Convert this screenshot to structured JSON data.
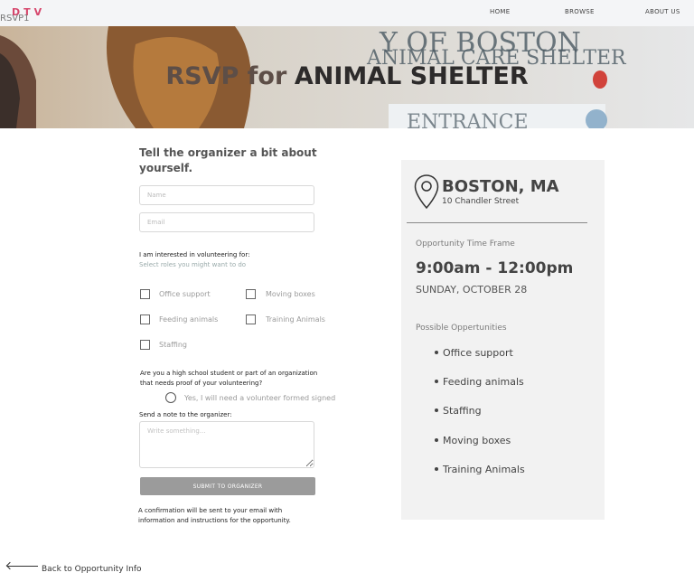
{
  "nav": {
    "logo": "DTV",
    "tab_title": "RSVP1",
    "links": [
      "HOME",
      "BROWSE",
      "ABOUT US"
    ]
  },
  "hero": {
    "title_part1": "RSVP for",
    "title_part2": "ANIMAL SHELTER",
    "background_sign_line1": "Y OF BOSTON",
    "background_sign_line2": "ANIMAL CARE SHELTER",
    "background_sign_line3": "ENTRANCE"
  },
  "form": {
    "heading": "Tell the organizer a bit about yourself.",
    "name_placeholder": "Name",
    "email_placeholder": "Email",
    "interest_label": "I am interested in volunteering for:",
    "interest_hint": "Select roles you might want to do",
    "roles": [
      "Office support",
      "Moving boxes",
      "Feeding animals",
      "Training Animals",
      "Staffing"
    ],
    "question": "Are you a high school student or part of an organization that needs proof of your volunteering?",
    "proof_option": "Yes, I will need a volunteer formed signed",
    "note_label": "Send a note to the organizer:",
    "note_placeholder": "Write something...",
    "submit_label": "SUBMIT TO ORGANIZER",
    "confirmation": "A confirmation will be sent to your email with information and instructions for the opportunity."
  },
  "details": {
    "city": "BOSTON, MA",
    "street": "10 Chandler Street",
    "time_label": "Opportunity Time Frame",
    "time": "9:00am - 12:00pm",
    "date": "SUNDAY, OCTOBER 28",
    "opportunities_label": "Possible Oppertunities",
    "opportunities": [
      "Office support",
      "Feeding animals",
      "Staffing",
      "Moving boxes",
      "Training Animals"
    ]
  },
  "footer": {
    "back_label": "Back to Opportunity Info"
  },
  "colors": {
    "logo": "#d6456b",
    "submit_bg": "#9b9b9b",
    "card_bg": "#f2f2f2"
  }
}
